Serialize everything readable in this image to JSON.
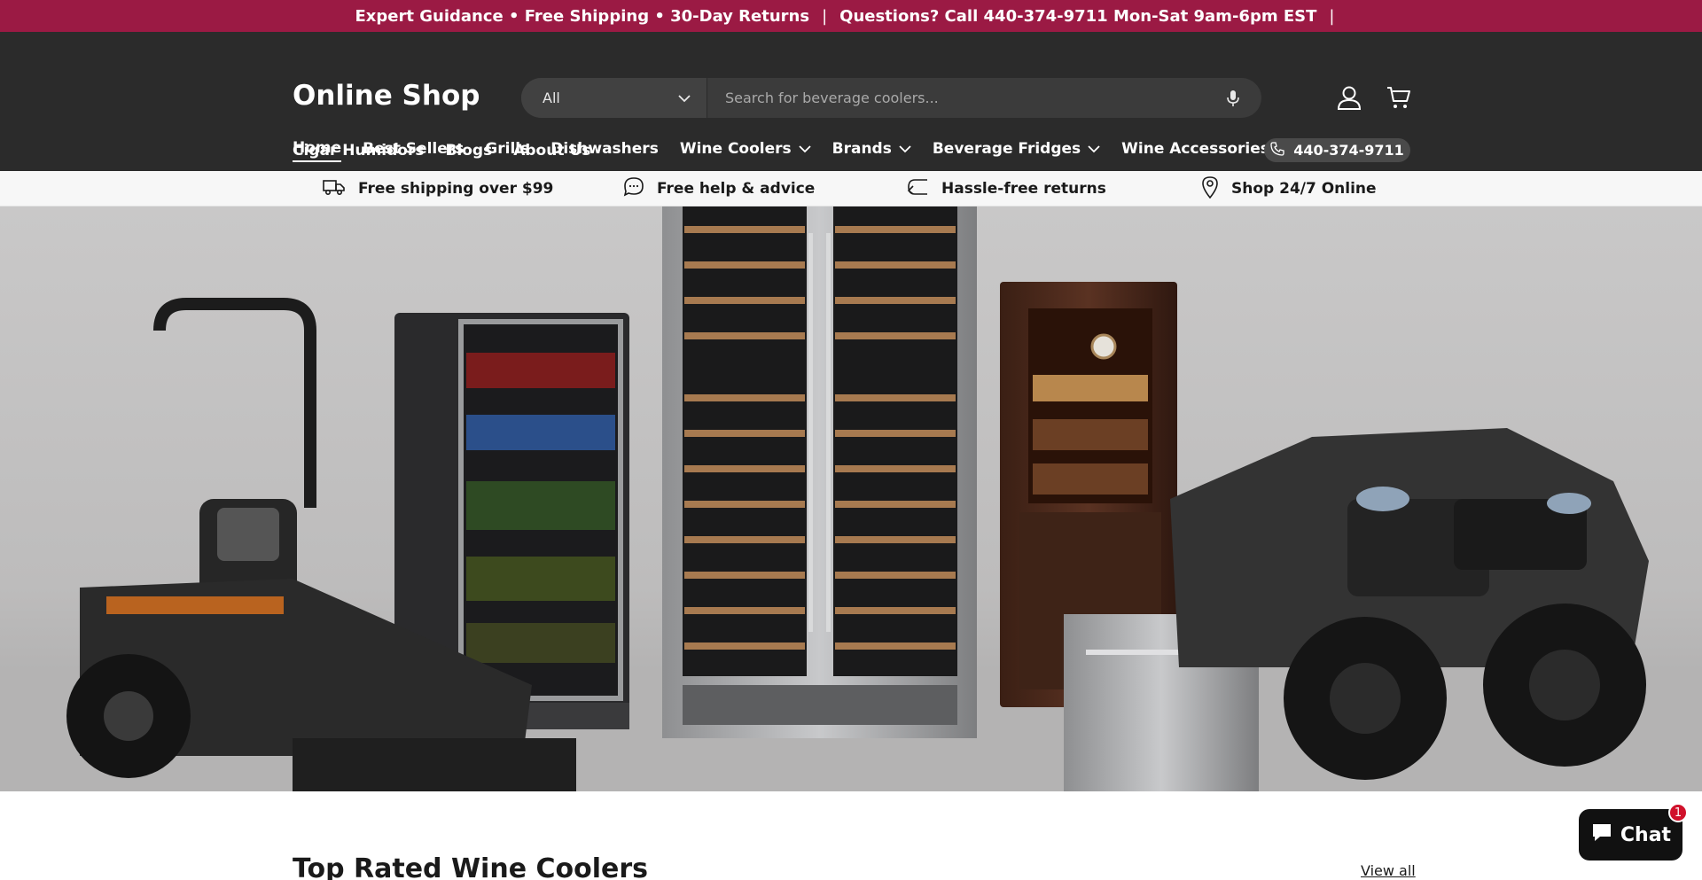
{
  "announcement": {
    "left": "Expert Guidance • Free Shipping • 30-Day Returns",
    "separator": "|",
    "right": "Questions? Call 440-374-9711 Mon-Sat 9am-6pm EST",
    "trail": "|"
  },
  "header": {
    "logo": "Online Shop",
    "search": {
      "category": "All",
      "placeholder": "Search for beverage coolers..."
    },
    "phone": "440-374-9711"
  },
  "nav": {
    "row1": [
      {
        "label": "Home",
        "active": true
      },
      {
        "label": "Best Sellers"
      },
      {
        "label": "Grills"
      },
      {
        "label": "Dishwashers"
      },
      {
        "label": "Wine Coolers",
        "dropdown": true
      },
      {
        "label": "Brands",
        "dropdown": true
      },
      {
        "label": "Beverage Fridges",
        "dropdown": true
      },
      {
        "label": "Wine Accessories",
        "dropdown": true
      }
    ],
    "row2": [
      {
        "label": "Cigar Humidors"
      },
      {
        "label": "Blogs"
      },
      {
        "label": "About Us"
      }
    ]
  },
  "features": [
    {
      "label": "Free shipping over $99",
      "icon": "truck-icon"
    },
    {
      "label": "Free help & advice",
      "icon": "chat-bubble-icon"
    },
    {
      "label": "Hassle-free returns",
      "icon": "return-arrow-icon"
    },
    {
      "label": "Shop 24/7 Online",
      "icon": "location-pin-icon"
    }
  ],
  "section": {
    "title": "Top Rated Wine Coolers",
    "view_all": "View all"
  },
  "chat": {
    "label": "Chat",
    "badge": "1"
  },
  "colors": {
    "announcement_bg": "#9b1a44",
    "header_bg": "#2b2b2b",
    "feature_bg": "#f7f7f7"
  }
}
